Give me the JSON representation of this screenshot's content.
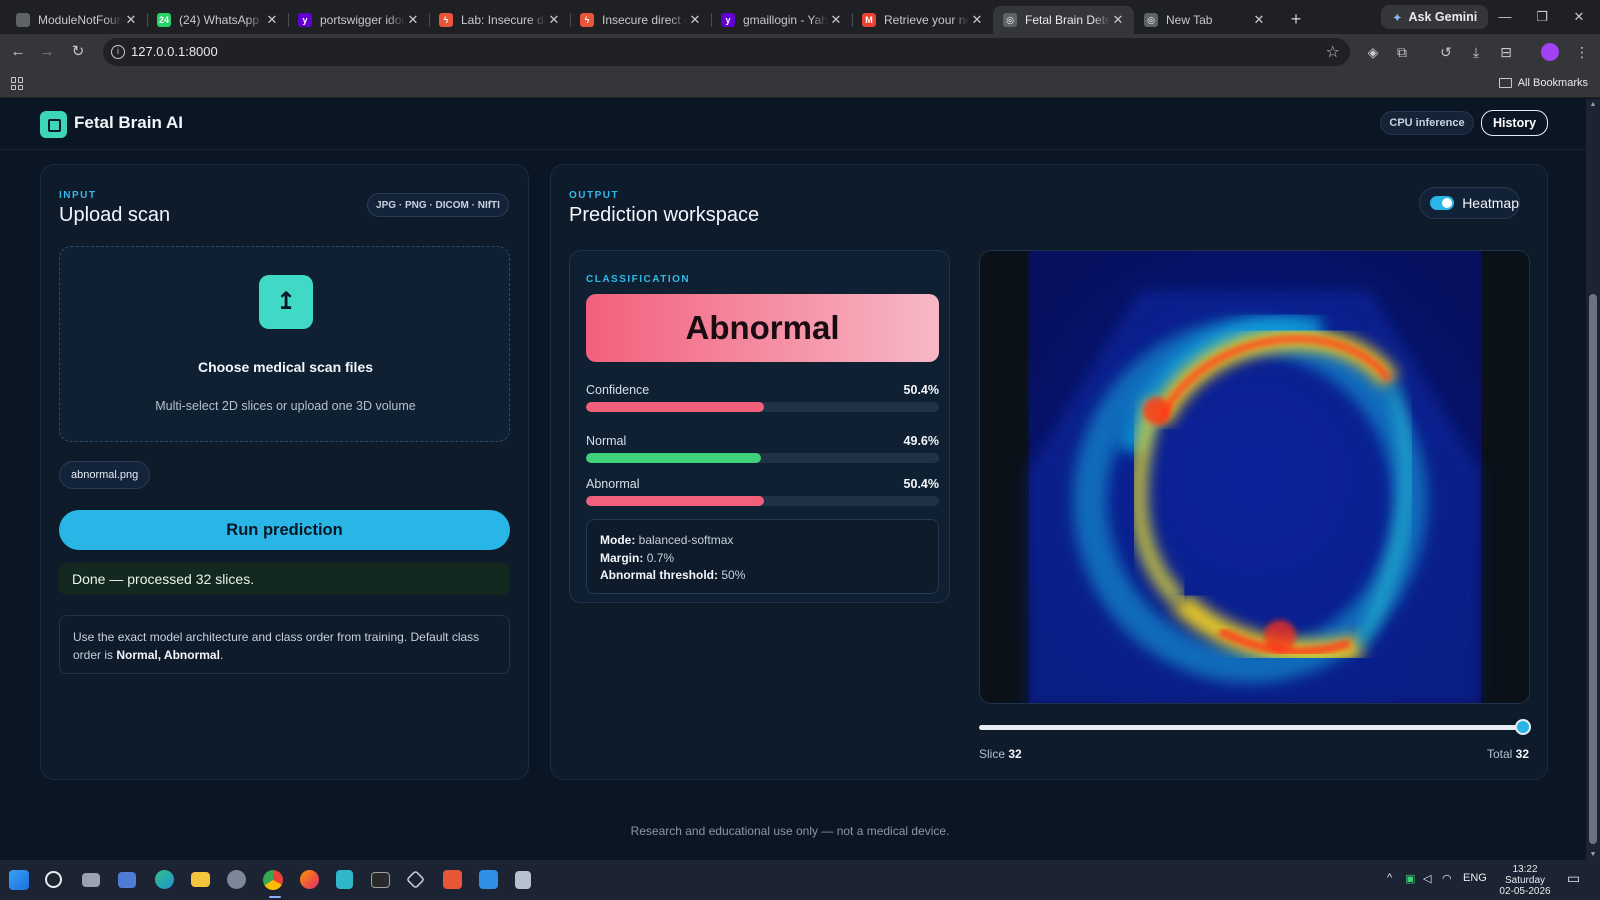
{
  "browser": {
    "tabs": [
      {
        "title": "ModuleNotFoundError",
        "favicon": "chrome-page-icon",
        "color": "#5f6368",
        "glyph": ""
      },
      {
        "title": "(24) WhatsApp",
        "favicon": "whatsapp-icon",
        "color": "#25d366",
        "glyph": "24"
      },
      {
        "title": "portswigger idor lab",
        "favicon": "yahoo-icon",
        "color": "#6001d2",
        "glyph": "y"
      },
      {
        "title": "Lab: Insecure direct object",
        "favicon": "portswigger-icon",
        "color": "#e8563a",
        "glyph": "ϟ"
      },
      {
        "title": "Insecure direct object",
        "favicon": "portswigger-icon",
        "color": "#e8563a",
        "glyph": "ϟ"
      },
      {
        "title": "gmaillogin - Yahoo",
        "favicon": "yahoo-icon",
        "color": "#6001d2",
        "glyph": "y"
      },
      {
        "title": "Retrieve your new",
        "favicon": "gmail-icon",
        "color": "#ea4335",
        "glyph": "M"
      },
      {
        "title": "Fetal Brain Detection",
        "favicon": "globe-icon",
        "color": "#5f6368",
        "glyph": "◎",
        "active": true
      },
      {
        "title": "New Tab",
        "favicon": "globe-icon",
        "color": "#5f6368",
        "glyph": "◎"
      }
    ],
    "gemini_label": "Ask Gemini",
    "url": "127.0.0.1:8000",
    "all_bookmarks": "All Bookmarks"
  },
  "app": {
    "brand": "Fetal Brain AI",
    "cpu_badge": "CPU inference",
    "history_button": "History"
  },
  "input": {
    "eyebrow": "INPUT",
    "title": "Upload scan",
    "formats": "JPG · PNG · DICOM · NIfTI",
    "drop_title": "Choose medical scan files",
    "drop_subtitle": "Multi-select 2D slices or upload one 3D volume",
    "file_chip": "abnormal.png",
    "run_button": "Run prediction",
    "status": "Done — processed 32 slices.",
    "note_text": "Use the exact model architecture and class order from training. Default class order is ",
    "note_bold": "Normal, Abnormal",
    "note_end": "."
  },
  "output": {
    "eyebrow": "OUTPUT",
    "title": "Prediction workspace",
    "heatmap_label": "Heatmap",
    "heatmap_on": true,
    "classification_eyebrow": "CLASSIFICATION",
    "prediction": "Abnormal",
    "metrics": [
      {
        "label": "Confidence",
        "value": "50.4%",
        "fraction": 0.504,
        "color": "#f2607c"
      },
      {
        "label": "Normal",
        "value": "49.6%",
        "fraction": 0.496,
        "color": "#3fd17a"
      },
      {
        "label": "Abnormal",
        "value": "50.4%",
        "fraction": 0.504,
        "color": "#f2607c"
      }
    ],
    "mode_label": "Mode:",
    "mode_value": "balanced-softmax",
    "margin_label": "Margin:",
    "margin_value": "0.7%",
    "threshold_label": "Abnormal threshold:",
    "threshold_value": "50%",
    "slice_label": "Slice",
    "slice_value": "32",
    "total_label": "Total",
    "total_value": "32",
    "slice_fraction": 1.0
  },
  "footer": "Research and educational use only — not a medical device.",
  "taskbar": {
    "lang": "ENG",
    "time": "13:22",
    "day": "Saturday",
    "date": "02-05-2026"
  }
}
